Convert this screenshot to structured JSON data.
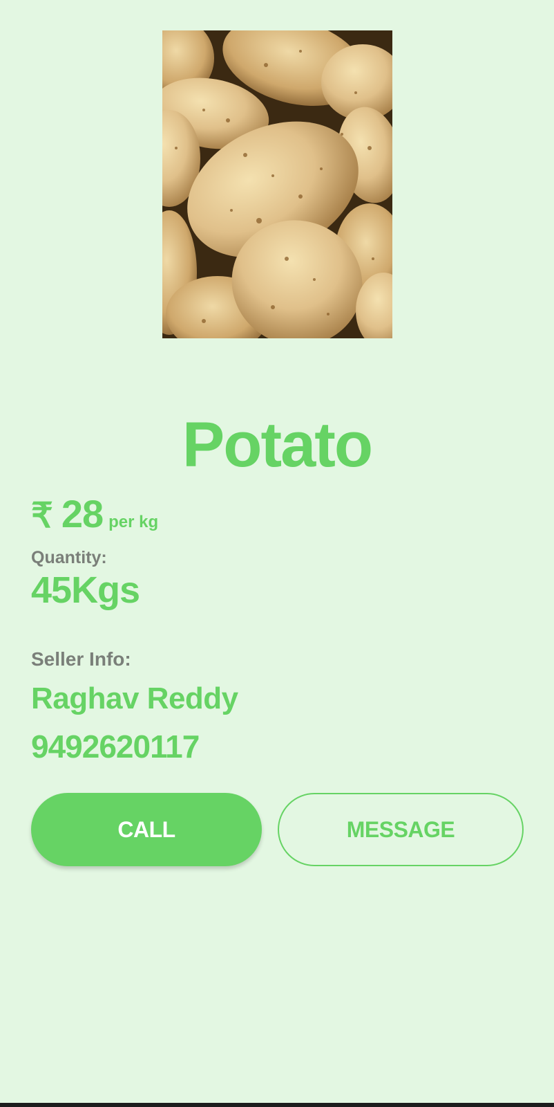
{
  "product": {
    "image_alt": "Potatoes",
    "name": "Potato",
    "price": {
      "currency_symbol": "₹",
      "value": "28",
      "unit": "per kg"
    },
    "quantity": {
      "label": "Quantity:",
      "value": "45Kgs"
    }
  },
  "seller": {
    "label": "Seller Info:",
    "name": "Raghav Reddy",
    "phone": "9492620117"
  },
  "actions": {
    "call_label": "CALL",
    "message_label": "MESSAGE"
  },
  "colors": {
    "background": "#e3f7e2",
    "accent": "#66d364",
    "muted_text": "#7a7f79"
  }
}
